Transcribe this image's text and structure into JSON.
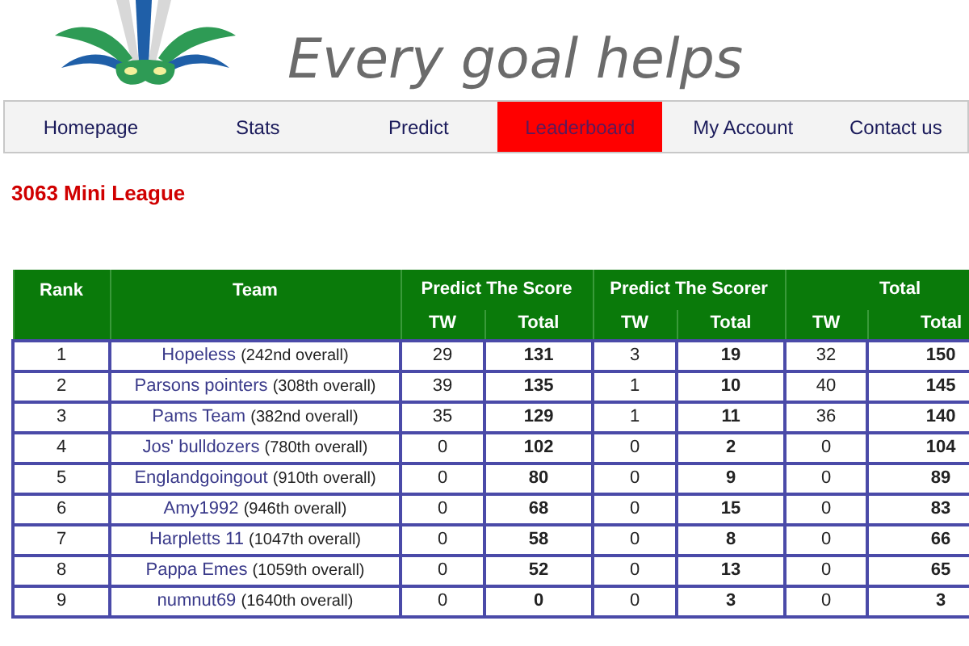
{
  "header": {
    "tagline": "Every goal helps"
  },
  "nav": [
    {
      "label": "Homepage",
      "selected": false
    },
    {
      "label": "Stats",
      "selected": false
    },
    {
      "label": "Predict",
      "selected": false
    },
    {
      "label": "Leaderboard",
      "selected": true
    },
    {
      "label": "My Account",
      "selected": false
    },
    {
      "label": "Contact us",
      "selected": false
    }
  ],
  "league_title": "3063 Mini League",
  "table": {
    "group_headers": [
      "Rank",
      "Team",
      "Predict The Score",
      "Predict The Scorer",
      "Total"
    ],
    "sub_headers": [
      "TW",
      "Total",
      "TW",
      "Total",
      "TW",
      "Total"
    ],
    "rows": [
      {
        "rank": "1",
        "team": "Hopeless",
        "overall": "(242nd overall)",
        "values": [
          "29",
          "131",
          "3",
          "19",
          "32",
          "150"
        ]
      },
      {
        "rank": "2",
        "team": "Parsons pointers",
        "overall": "(308th overall)",
        "values": [
          "39",
          "135",
          "1",
          "10",
          "40",
          "145"
        ]
      },
      {
        "rank": "3",
        "team": "Pams Team",
        "overall": "(382nd overall)",
        "values": [
          "35",
          "129",
          "1",
          "11",
          "36",
          "140"
        ]
      },
      {
        "rank": "4",
        "team": "Jos' bulldozers",
        "overall": "(780th overall)",
        "values": [
          "0",
          "102",
          "0",
          "2",
          "0",
          "104"
        ]
      },
      {
        "rank": "5",
        "team": "Englandgoingout",
        "overall": "(910th overall)",
        "values": [
          "0",
          "80",
          "0",
          "9",
          "0",
          "89"
        ]
      },
      {
        "rank": "6",
        "team": "Amy1992",
        "overall": "(946th overall)",
        "values": [
          "0",
          "68",
          "0",
          "15",
          "0",
          "83"
        ]
      },
      {
        "rank": "7",
        "team": "Harpletts 11",
        "overall": "(1047th overall)",
        "values": [
          "0",
          "58",
          "0",
          "8",
          "0",
          "66"
        ]
      },
      {
        "rank": "8",
        "team": "Pappa Emes",
        "overall": "(1059th overall)",
        "values": [
          "0",
          "52",
          "0",
          "13",
          "0",
          "65"
        ]
      },
      {
        "rank": "9",
        "team": "numnut69",
        "overall": "(1640th overall)",
        "values": [
          "0",
          "0",
          "0",
          "3",
          "0",
          "3"
        ]
      }
    ]
  }
}
